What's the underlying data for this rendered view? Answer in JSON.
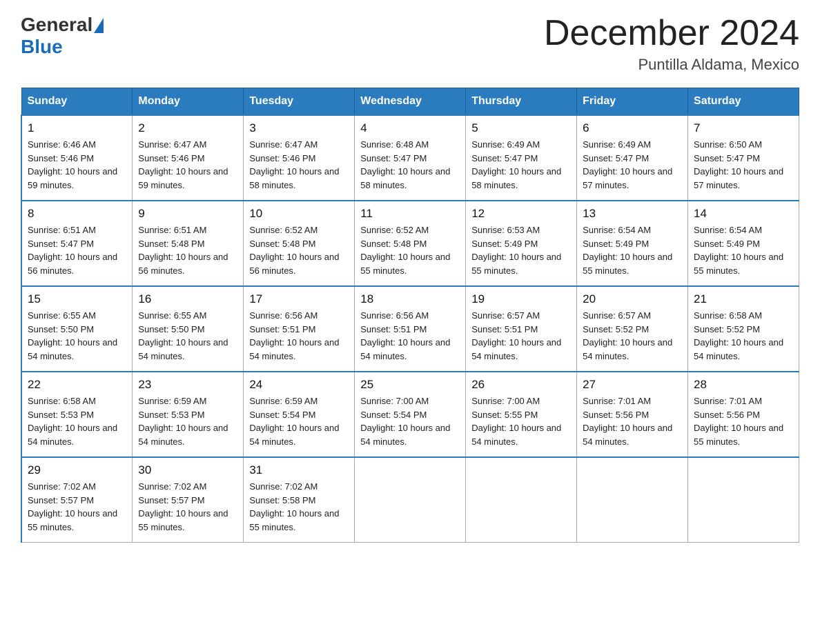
{
  "header": {
    "logo_general": "General",
    "logo_blue": "Blue",
    "title": "December 2024",
    "subtitle": "Puntilla Aldama, Mexico"
  },
  "calendar": {
    "days_of_week": [
      "Sunday",
      "Monday",
      "Tuesday",
      "Wednesday",
      "Thursday",
      "Friday",
      "Saturday"
    ],
    "weeks": [
      [
        {
          "day": "1",
          "sunrise": "6:46 AM",
          "sunset": "5:46 PM",
          "daylight": "10 hours and 59 minutes."
        },
        {
          "day": "2",
          "sunrise": "6:47 AM",
          "sunset": "5:46 PM",
          "daylight": "10 hours and 59 minutes."
        },
        {
          "day": "3",
          "sunrise": "6:47 AM",
          "sunset": "5:46 PM",
          "daylight": "10 hours and 58 minutes."
        },
        {
          "day": "4",
          "sunrise": "6:48 AM",
          "sunset": "5:47 PM",
          "daylight": "10 hours and 58 minutes."
        },
        {
          "day": "5",
          "sunrise": "6:49 AM",
          "sunset": "5:47 PM",
          "daylight": "10 hours and 58 minutes."
        },
        {
          "day": "6",
          "sunrise": "6:49 AM",
          "sunset": "5:47 PM",
          "daylight": "10 hours and 57 minutes."
        },
        {
          "day": "7",
          "sunrise": "6:50 AM",
          "sunset": "5:47 PM",
          "daylight": "10 hours and 57 minutes."
        }
      ],
      [
        {
          "day": "8",
          "sunrise": "6:51 AM",
          "sunset": "5:47 PM",
          "daylight": "10 hours and 56 minutes."
        },
        {
          "day": "9",
          "sunrise": "6:51 AM",
          "sunset": "5:48 PM",
          "daylight": "10 hours and 56 minutes."
        },
        {
          "day": "10",
          "sunrise": "6:52 AM",
          "sunset": "5:48 PM",
          "daylight": "10 hours and 56 minutes."
        },
        {
          "day": "11",
          "sunrise": "6:52 AM",
          "sunset": "5:48 PM",
          "daylight": "10 hours and 55 minutes."
        },
        {
          "day": "12",
          "sunrise": "6:53 AM",
          "sunset": "5:49 PM",
          "daylight": "10 hours and 55 minutes."
        },
        {
          "day": "13",
          "sunrise": "6:54 AM",
          "sunset": "5:49 PM",
          "daylight": "10 hours and 55 minutes."
        },
        {
          "day": "14",
          "sunrise": "6:54 AM",
          "sunset": "5:49 PM",
          "daylight": "10 hours and 55 minutes."
        }
      ],
      [
        {
          "day": "15",
          "sunrise": "6:55 AM",
          "sunset": "5:50 PM",
          "daylight": "10 hours and 54 minutes."
        },
        {
          "day": "16",
          "sunrise": "6:55 AM",
          "sunset": "5:50 PM",
          "daylight": "10 hours and 54 minutes."
        },
        {
          "day": "17",
          "sunrise": "6:56 AM",
          "sunset": "5:51 PM",
          "daylight": "10 hours and 54 minutes."
        },
        {
          "day": "18",
          "sunrise": "6:56 AM",
          "sunset": "5:51 PM",
          "daylight": "10 hours and 54 minutes."
        },
        {
          "day": "19",
          "sunrise": "6:57 AM",
          "sunset": "5:51 PM",
          "daylight": "10 hours and 54 minutes."
        },
        {
          "day": "20",
          "sunrise": "6:57 AM",
          "sunset": "5:52 PM",
          "daylight": "10 hours and 54 minutes."
        },
        {
          "day": "21",
          "sunrise": "6:58 AM",
          "sunset": "5:52 PM",
          "daylight": "10 hours and 54 minutes."
        }
      ],
      [
        {
          "day": "22",
          "sunrise": "6:58 AM",
          "sunset": "5:53 PM",
          "daylight": "10 hours and 54 minutes."
        },
        {
          "day": "23",
          "sunrise": "6:59 AM",
          "sunset": "5:53 PM",
          "daylight": "10 hours and 54 minutes."
        },
        {
          "day": "24",
          "sunrise": "6:59 AM",
          "sunset": "5:54 PM",
          "daylight": "10 hours and 54 minutes."
        },
        {
          "day": "25",
          "sunrise": "7:00 AM",
          "sunset": "5:54 PM",
          "daylight": "10 hours and 54 minutes."
        },
        {
          "day": "26",
          "sunrise": "7:00 AM",
          "sunset": "5:55 PM",
          "daylight": "10 hours and 54 minutes."
        },
        {
          "day": "27",
          "sunrise": "7:01 AM",
          "sunset": "5:56 PM",
          "daylight": "10 hours and 54 minutes."
        },
        {
          "day": "28",
          "sunrise": "7:01 AM",
          "sunset": "5:56 PM",
          "daylight": "10 hours and 55 minutes."
        }
      ],
      [
        {
          "day": "29",
          "sunrise": "7:02 AM",
          "sunset": "5:57 PM",
          "daylight": "10 hours and 55 minutes."
        },
        {
          "day": "30",
          "sunrise": "7:02 AM",
          "sunset": "5:57 PM",
          "daylight": "10 hours and 55 minutes."
        },
        {
          "day": "31",
          "sunrise": "7:02 AM",
          "sunset": "5:58 PM",
          "daylight": "10 hours and 55 minutes."
        },
        null,
        null,
        null,
        null
      ]
    ]
  }
}
